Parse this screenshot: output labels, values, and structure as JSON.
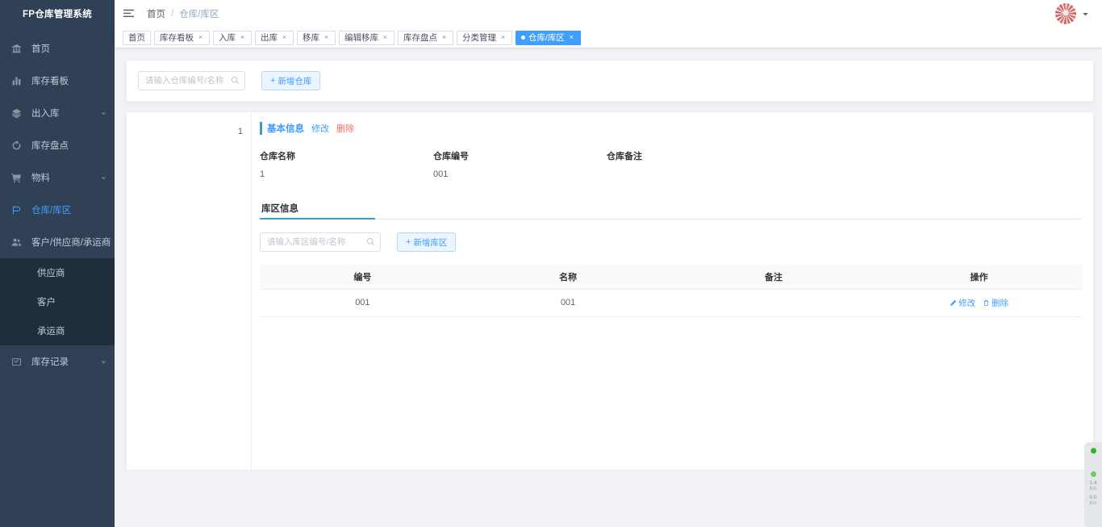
{
  "sidebar": {
    "logo": "FP仓库管理系统",
    "items": [
      {
        "label": "首页",
        "icon": "dashboard-icon",
        "expandable": false,
        "active": false
      },
      {
        "label": "库存看板",
        "icon": "chart-bar-icon",
        "expandable": false,
        "active": false
      },
      {
        "label": "出入库",
        "icon": "layers-icon",
        "expandable": true,
        "active": false
      },
      {
        "label": "库存盘点",
        "icon": "refresh-icon",
        "expandable": false,
        "active": false
      },
      {
        "label": "物料",
        "icon": "cart-icon",
        "expandable": true,
        "active": false
      },
      {
        "label": "仓库/库区",
        "icon": "warehouse-icon",
        "expandable": false,
        "active": true
      },
      {
        "label": "客户/供应商/承运商",
        "icon": "people-icon",
        "expandable": true,
        "active": false
      },
      {
        "label": "库存记录",
        "icon": "record-icon",
        "expandable": true,
        "active": false
      }
    ],
    "submenu": [
      {
        "label": "供应商"
      },
      {
        "label": "客户"
      },
      {
        "label": "承运商"
      }
    ]
  },
  "navbar": {
    "hamburger_icon": "hamburger-icon",
    "breadcrumb": {
      "home": "首页",
      "separator": "/",
      "current": "仓库/库区"
    },
    "avatar_icon": "user-avatar",
    "caret_icon": "caret-down-icon"
  },
  "tabs": [
    {
      "label": "首页",
      "closable": false,
      "active": false
    },
    {
      "label": "库存看板",
      "closable": true,
      "active": false
    },
    {
      "label": "入库",
      "closable": true,
      "active": false
    },
    {
      "label": "出库",
      "closable": true,
      "active": false
    },
    {
      "label": "移库",
      "closable": true,
      "active": false
    },
    {
      "label": "编辑移库",
      "closable": true,
      "active": false
    },
    {
      "label": "库存盘点",
      "closable": true,
      "active": false
    },
    {
      "label": "分类管理",
      "closable": true,
      "active": false
    },
    {
      "label": "仓库/库区",
      "closable": true,
      "active": true
    }
  ],
  "filter": {
    "search_placeholder": "请输入仓库编号/名称",
    "search_value": "",
    "search_icon": "search-icon",
    "add_warehouse_label": "新增仓库",
    "add_plus": "+"
  },
  "tree": {
    "nodes": [
      {
        "label": "1"
      }
    ]
  },
  "detail": {
    "section_title": "基本信息",
    "edit_label": "修改",
    "delete_label": "删除",
    "fields": [
      {
        "label": "仓库名称",
        "value": "1"
      },
      {
        "label": "仓库编号",
        "value": "001"
      },
      {
        "label": "仓库备注",
        "value": ""
      }
    ],
    "sub_tab_label": "库区信息",
    "zone_search_placeholder": "请输入库区编号/名称",
    "zone_search_value": "",
    "add_zone_label": "新增库区",
    "add_plus": "+",
    "table": {
      "columns": [
        "编号",
        "名称",
        "备注",
        "操作"
      ],
      "rows": [
        {
          "code": "001",
          "name": "001",
          "remark": "",
          "edit": "修改",
          "delete": "删除"
        }
      ]
    }
  },
  "net_widget": {
    "down_value": "1.4",
    "down_unit": "K/s",
    "up_value": "0.0",
    "up_unit": "K/s"
  },
  "colors": {
    "sidebar_bg": "#304156",
    "submenu_bg": "#1f2d3d",
    "accent_blue": "#409eff",
    "accent_teal": "#39a1bb",
    "danger_red": "#f56c6c",
    "page_bg": "#f0f2f5"
  }
}
